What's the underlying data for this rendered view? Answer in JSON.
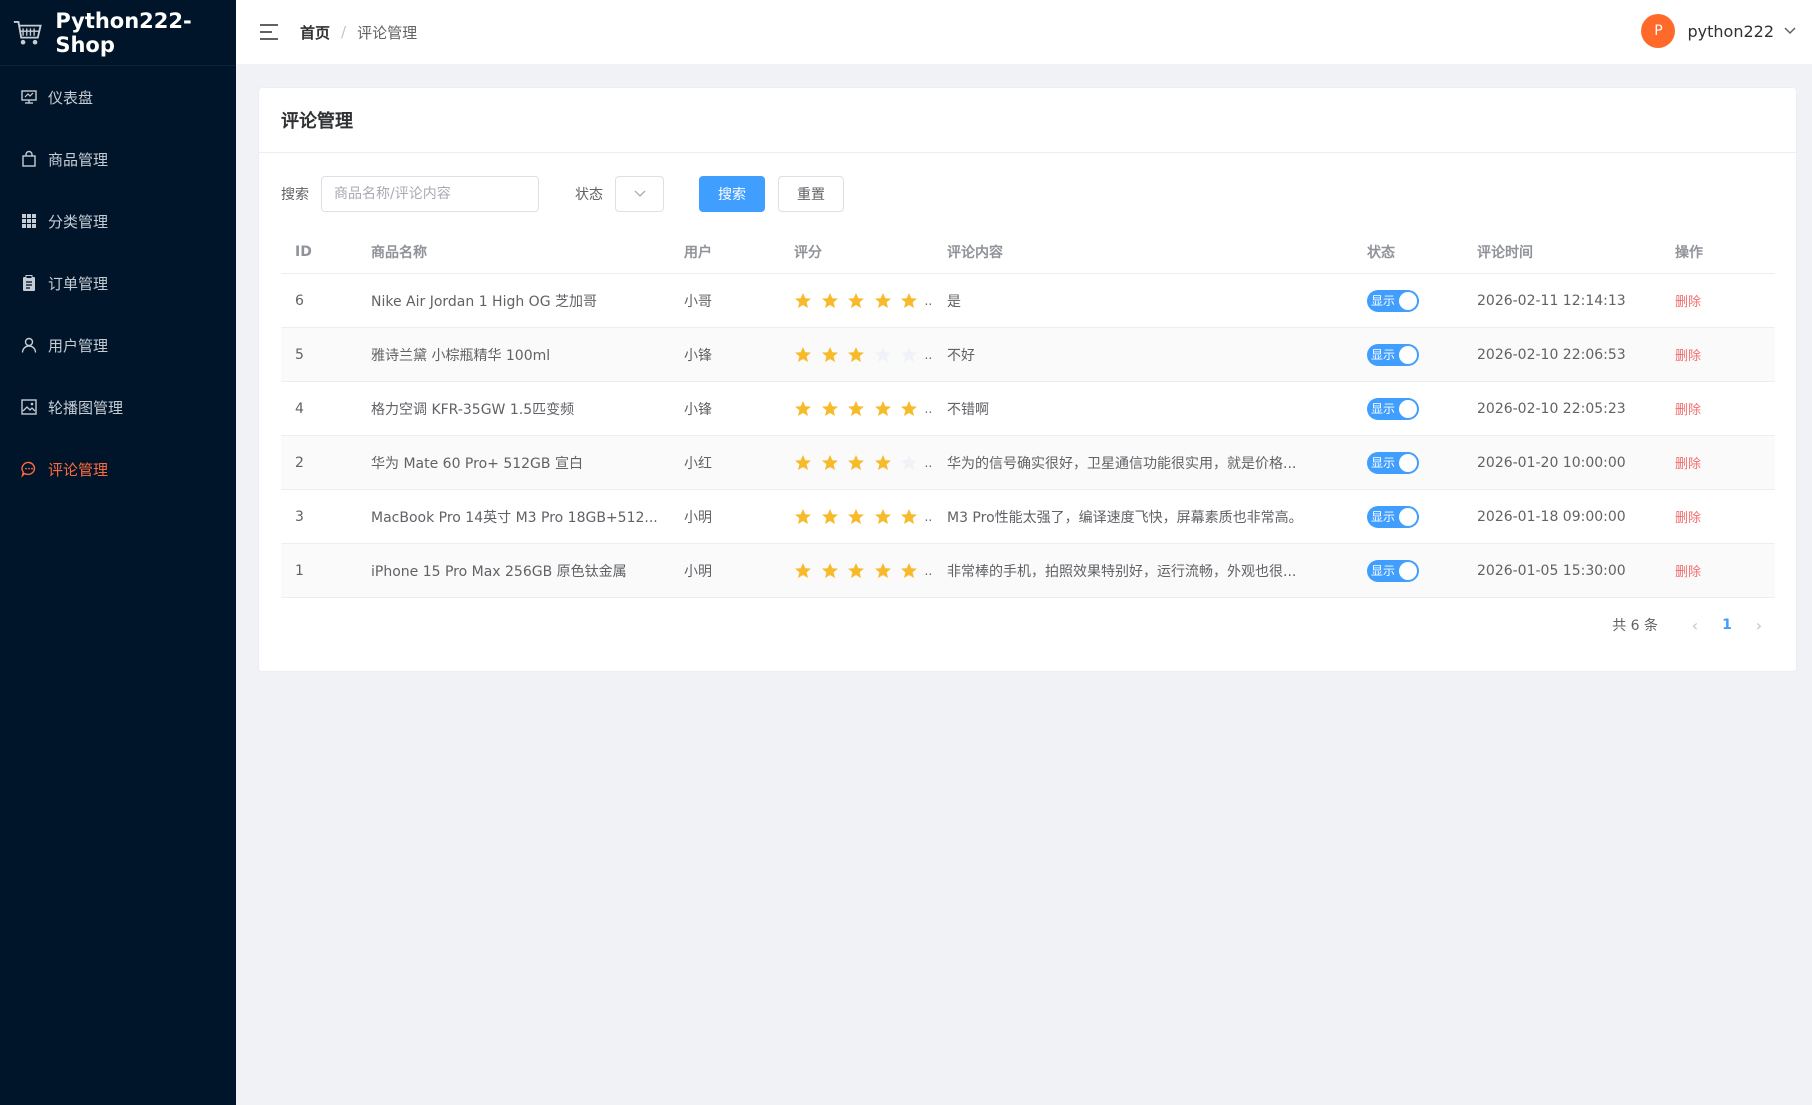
{
  "brand": {
    "name": "Python222-Shop"
  },
  "sidebar": {
    "items": [
      {
        "label": "仪表盘",
        "icon": "dashboard-icon",
        "active": false
      },
      {
        "label": "商品管理",
        "icon": "shopping-bag-icon",
        "active": false
      },
      {
        "label": "分类管理",
        "icon": "grid-icon",
        "active": false
      },
      {
        "label": "订单管理",
        "icon": "clipboard-icon",
        "active": false
      },
      {
        "label": "用户管理",
        "icon": "user-icon",
        "active": false
      },
      {
        "label": "轮播图管理",
        "icon": "picture-icon",
        "active": false
      },
      {
        "label": "评论管理",
        "icon": "comment-icon",
        "active": true
      }
    ]
  },
  "header": {
    "breadcrumb": {
      "home": "首页",
      "separator": "/",
      "current": "评论管理"
    },
    "user": {
      "avatar_letter": "P",
      "name": "python222"
    }
  },
  "card": {
    "title": "评论管理",
    "search": {
      "label": "搜索",
      "placeholder": "商品名称/评论内容",
      "value": ""
    },
    "status": {
      "label": "状态",
      "value": ""
    },
    "buttons": {
      "search": "搜索",
      "reset": "重置"
    }
  },
  "table": {
    "columns": [
      "ID",
      "商品名称",
      "用户",
      "评分",
      "评论内容",
      "状态",
      "评论时间",
      "操作"
    ],
    "rows": [
      {
        "id": "6",
        "product": "Nike Air Jordan 1 High OG 芝加哥",
        "user": "小哥",
        "rating": 5,
        "content": "是",
        "status": "显示",
        "time": "2026-02-11 12:14:13",
        "action": "删除"
      },
      {
        "id": "5",
        "product": "雅诗兰黛 小棕瓶精华 100ml",
        "user": "小锋",
        "rating": 3,
        "content": "不好",
        "status": "显示",
        "time": "2026-02-10 22:06:53",
        "action": "删除"
      },
      {
        "id": "4",
        "product": "格力空调 KFR-35GW 1.5匹变频",
        "user": "小锋",
        "rating": 5,
        "content": "不错啊",
        "status": "显示",
        "time": "2026-02-10 22:05:23",
        "action": "删除"
      },
      {
        "id": "2",
        "product": "华为 Mate 60 Pro+ 512GB 宣白",
        "user": "小红",
        "rating": 4,
        "content": "华为的信号确实很好，卫星通信功能很实用，就是价格...",
        "status": "显示",
        "time": "2026-01-20 10:00:00",
        "action": "删除"
      },
      {
        "id": "3",
        "product": "MacBook Pro 14英寸 M3 Pro 18GB+512...",
        "user": "小明",
        "rating": 5,
        "content": "M3 Pro性能太强了，编译速度飞快，屏幕素质也非常高。",
        "status": "显示",
        "time": "2026-01-18 09:00:00",
        "action": "删除"
      },
      {
        "id": "1",
        "product": "iPhone 15 Pro Max 256GB 原色钛金属",
        "user": "小明",
        "rating": 5,
        "content": "非常棒的手机，拍照效果特别好，运行流畅，外观也很...",
        "status": "显示",
        "time": "2026-01-05 15:30:00",
        "action": "删除"
      }
    ],
    "rating_ellipsis": "..."
  },
  "pagination": {
    "total_text": "共 6 条",
    "current_page": "1",
    "prev": "‹",
    "next": "›"
  },
  "colors": {
    "sidebar_bg": "#001529",
    "active_menu": "#ff6a3d",
    "primary": "#409eff",
    "danger": "#f56c6c",
    "star_filled": "#f7ba2a",
    "star_empty": "#eff2f7",
    "avatar_bg": "#ff6a2a"
  }
}
